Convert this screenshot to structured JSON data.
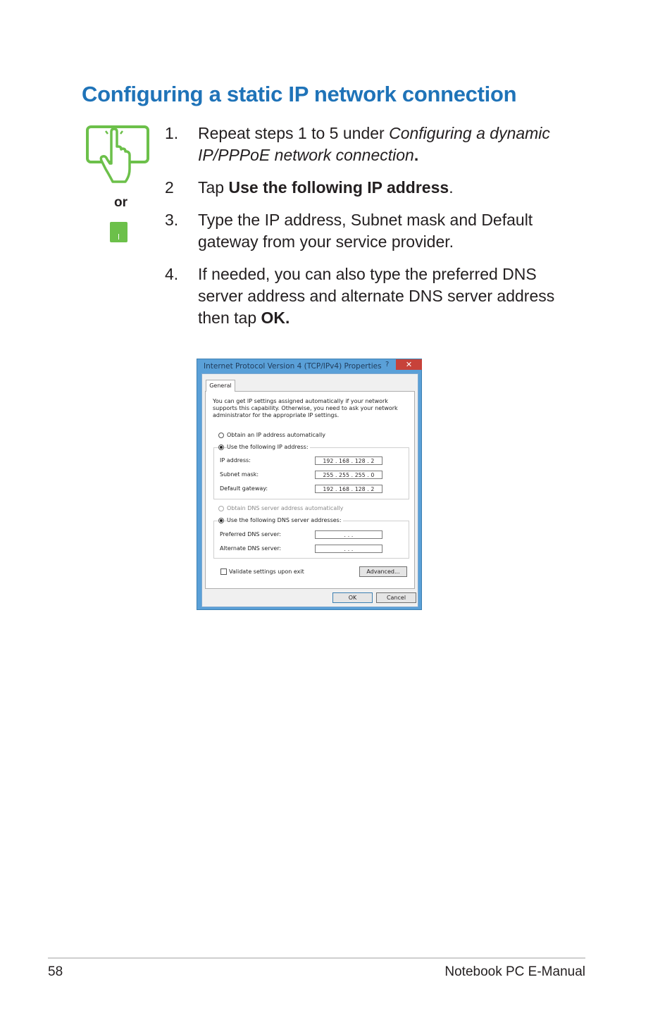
{
  "heading": "Configuring a static IP network connection",
  "steps": [
    {
      "num": "1.",
      "text_a": "Repeat steps 1 to 5 under ",
      "text_em": "Configuring a dynamic IP/PPPoE network connection",
      "text_b": "."
    },
    {
      "num": "2",
      "text_a": "Tap ",
      "text_strong": "Use the following IP address",
      "text_b": "."
    },
    {
      "num": "3.",
      "text": "Type the IP address, Subnet mask and Default gateway from your service provider."
    },
    {
      "num": "4.",
      "text_a": "If needed, you can also type the preferred DNS server address and alternate DNS server address then tap ",
      "text_strong": "OK."
    }
  ],
  "or_label": "or",
  "colors": {
    "heading": "#1f73b8",
    "icon_green": "#6cc04a"
  },
  "dialog": {
    "title": "Internet Protocol Version 4 (TCP/IPv4) Properties",
    "help": "?",
    "close": "✕",
    "tab": "General",
    "intro": "You can get IP settings assigned automatically if your network supports this capability. Otherwise, you need to ask your network administrator for the appropriate IP settings.",
    "radio_auto_ip": "Obtain an IP address automatically",
    "radio_use_ip": "Use the following IP address:",
    "ip_label": "IP address:",
    "ip_value": "192 . 168 . 128 .  2",
    "subnet_label": "Subnet mask:",
    "subnet_value": "255 . 255 . 255 .  0",
    "gateway_label": "Default gateway:",
    "gateway_value": "192 . 168 . 128 .  2",
    "radio_auto_dns": "Obtain DNS server address automatically",
    "radio_use_dns": "Use the following DNS server addresses:",
    "preferred_label": "Preferred DNS server:",
    "preferred_value": ".       .       .",
    "alternate_label": "Alternate DNS server:",
    "alternate_value": ".       .       .",
    "validate_label": "Validate settings upon exit",
    "advanced_button": "Advanced...",
    "ok_button": "OK",
    "cancel_button": "Cancel"
  },
  "footer": {
    "page_number": "58",
    "title": "Notebook PC E-Manual"
  }
}
